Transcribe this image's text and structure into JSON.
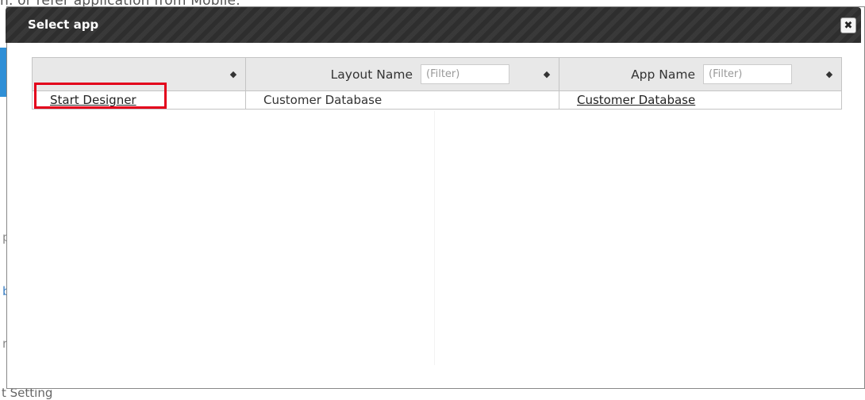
{
  "background": {
    "top_text": "n. or refer application from Mobile.",
    "bottom_text": "t Setting",
    "left_letters": [
      "p",
      "b",
      "r"
    ]
  },
  "dialog": {
    "title": "Select app",
    "close_glyph": "✖"
  },
  "table": {
    "columns": [
      {
        "label": "",
        "has_filter": false
      },
      {
        "label": "Layout Name",
        "filter_placeholder": "(Filter)"
      },
      {
        "label": "App Name",
        "filter_placeholder": "(Filter)"
      }
    ],
    "sort_glyph": "◆",
    "rows": [
      {
        "action": "Start Designer",
        "layout_name": "Customer Database",
        "app_name": "Customer Database"
      }
    ]
  },
  "colors": {
    "titlebar": "#2e2e2e",
    "highlight": "#e3001b",
    "header_bg": "#e8e8e8"
  }
}
